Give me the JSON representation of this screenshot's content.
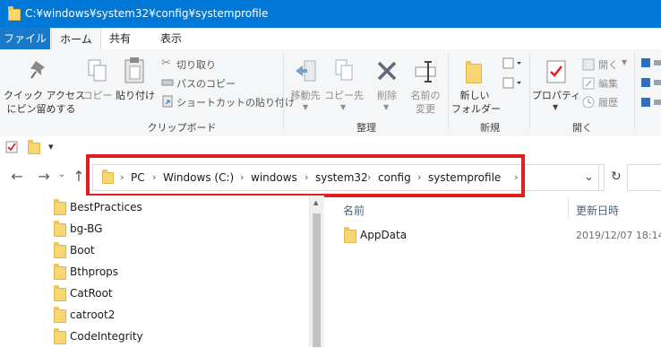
{
  "window": {
    "title": "C:¥windows¥system32¥config¥systemprofile"
  },
  "ribbon_tabs": [
    "ファイル",
    "ホーム",
    "共有",
    "表示"
  ],
  "ribbon": {
    "pin_label_1": "クイック アクセス",
    "pin_label_2": "にピン留めする",
    "copy": "コピー",
    "paste": "貼り付け",
    "cut": "切り取り",
    "copy_path": "パスのコピー",
    "paste_shortcut": "ショートカットの貼り付け",
    "group_clipboard": "クリップボード",
    "move_to": "移動先",
    "copy_to": "コピー先",
    "delete": "削除",
    "rename_1": "名前の",
    "rename_2": "変更",
    "group_organize": "整理",
    "new_folder_1": "新しい",
    "new_folder_2": "フォルダー",
    "group_new": "新規",
    "properties": "プロパティ",
    "open": "開く",
    "edit": "編集",
    "history": "履歴",
    "group_open": "開く"
  },
  "qat": {
    "dropdown_glyph": "▾"
  },
  "nav": {
    "back": "←",
    "forward": "→",
    "up": "↑",
    "down": "⌄",
    "refresh": "↻",
    "address_chevron": "⌄"
  },
  "breadcrumb": [
    "PC",
    "Windows (C:)",
    "windows",
    "system32",
    "config",
    "systemprofile"
  ],
  "tree_items": [
    "BestPractices",
    "bg-BG",
    "Boot",
    "Bthprops",
    "CatRoot",
    "catroot2",
    "CodeIntegrity"
  ],
  "file_list": {
    "headers": {
      "name": "名前",
      "modified": "更新日時"
    },
    "rows": [
      {
        "name": "AppData",
        "modified": "2019/12/07 18:14"
      }
    ]
  },
  "colors": {
    "titlebar": "#0078d7",
    "file_tab": "#1979ca",
    "highlight": "#e0201f",
    "folder": "#f7d774"
  }
}
